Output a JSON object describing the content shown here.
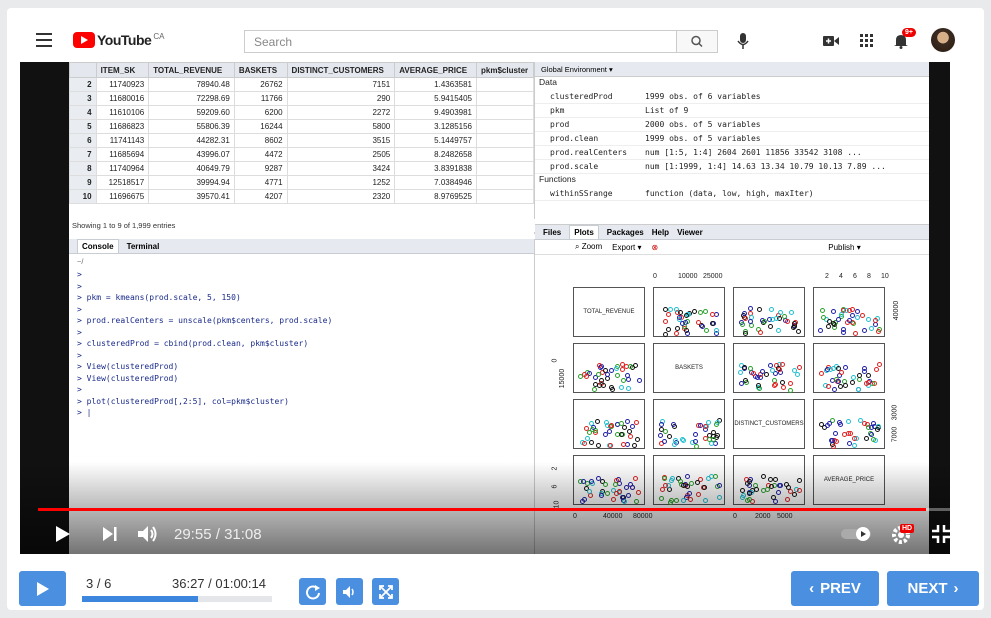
{
  "youtube": {
    "logo_text": "YouTube",
    "region": "CA",
    "search_placeholder": "Search",
    "notifications_badge": "9+"
  },
  "rstudio": {
    "table": {
      "headers": [
        "",
        "ITEM_SK",
        "TOTAL_REVENUE",
        "BASKETS",
        "DISTINCT_CUSTOMERS",
        "AVERAGE_PRICE",
        "pkm$cluster"
      ],
      "rows": [
        [
          "2",
          "11740923",
          "78940.48",
          "26762",
          "7151",
          "1.4363581"
        ],
        [
          "3",
          "11680016",
          "72298.69",
          "11766",
          "290",
          "5.9415405"
        ],
        [
          "4",
          "11610106",
          "59209.60",
          "6200",
          "2272",
          "9.4903981"
        ],
        [
          "5",
          "11686823",
          "55806.39",
          "16244",
          "5800",
          "3.1285156"
        ],
        [
          "6",
          "11741143",
          "44282.31",
          "8602",
          "3515",
          "5.1449757"
        ],
        [
          "7",
          "11685694",
          "43996.07",
          "4472",
          "2505",
          "8.2482658"
        ],
        [
          "8",
          "11740964",
          "40649.79",
          "9287",
          "3424",
          "3.8391838"
        ],
        [
          "9",
          "12518517",
          "39994.94",
          "4771",
          "1252",
          "7.0384946"
        ],
        [
          "10",
          "11696675",
          "39570.41",
          "4207",
          "2320",
          "8.9769525"
        ]
      ],
      "footer": "Showing 1 to 9 of 1,999 entries"
    },
    "console": {
      "tab_console": "Console",
      "tab_terminal": "Terminal",
      "path": "~/",
      "lines": [
        ">",
        ">",
        "> pkm = kmeans(prod.scale, 5, 150)",
        ">",
        "> prod.realCenters = unscale(pkm$centers, prod.scale)",
        ">",
        "> clusteredProd = cbind(prod.clean, pkm$cluster)",
        ">",
        "> View(clusteredProd)",
        "> View(clusteredProd)",
        ">",
        "> plot(clusteredProd[,2:5], col=pkm$cluster)",
        "> |"
      ]
    },
    "environment": {
      "scope": "Global Environment",
      "section_data": "Data",
      "section_functions": "Functions",
      "rows": [
        {
          "name": "clusteredProd",
          "value": "1999 obs. of 6 variables"
        },
        {
          "name": "pkm",
          "value": "List of 9"
        },
        {
          "name": "prod",
          "value": "2000 obs. of 5 variables"
        },
        {
          "name": "prod.clean",
          "value": "1999 obs. of 5 variables"
        },
        {
          "name": "prod.realCenters",
          "value": "num [1:5, 1:4] 2604 2601 11856 33542 3108 ..."
        },
        {
          "name": "prod.scale",
          "value": "num [1:1999, 1:4] 14.63 13.34 10.79 10.13 7.89 ..."
        }
      ],
      "func_rows": [
        {
          "name": "withinSSrange",
          "value": "function (data, low, high, maxIter)"
        }
      ]
    },
    "plots_panel": {
      "tabs": [
        "Files",
        "Plots",
        "Packages",
        "Help",
        "Viewer"
      ],
      "zoom_label": "Zoom",
      "export_label": "Export",
      "publish_label": "Publish",
      "var_labels": [
        "TOTAL_REVENUE",
        "BASKETS",
        "DISTINCT_CUSTOMERS",
        "AVERAGE_PRICE"
      ],
      "top_ticks_a": [
        "0",
        "10000",
        "25000"
      ],
      "top_ticks_b": [
        "2",
        "4",
        "6",
        "8",
        "10"
      ],
      "right_ticks_a": [
        "40000"
      ],
      "right_ticks_b": [
        "3000",
        "7000"
      ],
      "left_ticks_a": [
        "0",
        "15000"
      ],
      "left_ticks_b": [
        "2",
        "6",
        "10"
      ],
      "bottom_ticks_a": [
        "0",
        "40000",
        "80000"
      ],
      "bottom_ticks_b": [
        "0",
        "2000",
        "5000"
      ]
    }
  },
  "player": {
    "time_current": "29:55",
    "time_total": "31:08",
    "progress_fraction": 0.961,
    "hd_badge": "HD"
  },
  "course_bar": {
    "counter": "3 / 6",
    "time": "36:27 / 01:00:14",
    "progress_fraction": 0.61,
    "prev_label": "PREV",
    "next_label": "NEXT"
  }
}
